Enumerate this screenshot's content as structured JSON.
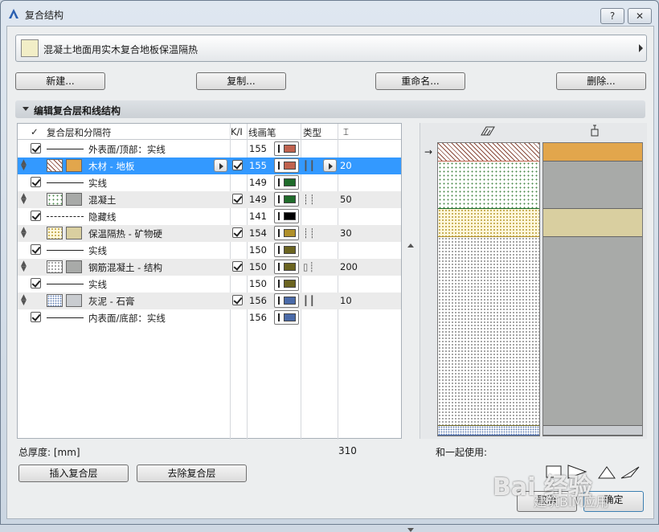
{
  "window": {
    "title": "复合结构",
    "help_label": "?",
    "close_label": "✕"
  },
  "selector": {
    "label": "混凝土地面用实木复合地板保温隔热"
  },
  "actions": {
    "new": "新建...",
    "copy": "复制...",
    "rename": "重命名...",
    "delete": "删除..."
  },
  "section": {
    "title": "编辑复合层和线结构"
  },
  "table": {
    "headers": {
      "check": "✓",
      "name": "复合层和分隔符",
      "vis": "K/I",
      "pen": "线画笔",
      "type": "类型",
      "thick": "⌶"
    },
    "rows": [
      {
        "kind": "line",
        "checked": true,
        "name": "外表面/顶部：实线",
        "pen": "155",
        "pen_color": "#c0624e",
        "dash": false
      },
      {
        "kind": "layer",
        "selected": true,
        "name": "木材 - 地板",
        "color": "#e2a64c",
        "hatch": "wood",
        "vis": true,
        "pen": "155",
        "pen_color": "#c0624e",
        "type": "┃┃",
        "thick": "20"
      },
      {
        "kind": "line",
        "checked": true,
        "name": "实线",
        "pen": "149",
        "pen_color": "#1f6b2a",
        "dash": false
      },
      {
        "kind": "layer",
        "name": "混凝土",
        "color": "#a8aaa8",
        "hatch": "concrete",
        "vis": true,
        "pen": "149",
        "pen_color": "#1f6b2a",
        "type": "┊┊",
        "thick": "50"
      },
      {
        "kind": "line",
        "checked": true,
        "name": "隐藏线",
        "pen": "141",
        "pen_color": "#000000",
        "dash": true
      },
      {
        "kind": "layer",
        "name": "保温隔热 - 矿物硬",
        "color": "#d9cfa0",
        "hatch": "insulation",
        "vis": true,
        "pen": "154",
        "pen_color": "#b0902a",
        "type": "┊┊",
        "thick": "30"
      },
      {
        "kind": "line",
        "checked": true,
        "name": "实线",
        "pen": "150",
        "pen_color": "#6b6420",
        "dash": false
      },
      {
        "kind": "layer",
        "name": "钢筋混凝土 - 结构",
        "color": "#a8aaa8",
        "hatch": "rc",
        "vis": true,
        "pen": "150",
        "pen_color": "#6b6420",
        "type": "▯┊",
        "thick": "200"
      },
      {
        "kind": "line",
        "checked": true,
        "name": "实线",
        "pen": "150",
        "pen_color": "#6b6420",
        "dash": false
      },
      {
        "kind": "layer",
        "name": "灰泥 - 石膏",
        "color": "#c9ccd0",
        "hatch": "plaster",
        "vis": true,
        "pen": "156",
        "pen_color": "#4a6aa8",
        "type": "┃┃",
        "thick": "10"
      },
      {
        "kind": "line",
        "checked": true,
        "name": "内表面/底部：实线",
        "pen": "156",
        "pen_color": "#4a6aa8",
        "dash": false
      }
    ]
  },
  "footer": {
    "total_label": "总厚度: [mm]",
    "total_value": "310",
    "insert": "插入复合层",
    "remove": "去除复合层",
    "used_with": "和一起使用:"
  },
  "dialog_buttons": {
    "cancel": "取消",
    "ok": "确定"
  },
  "watermark": {
    "baidu": "Bai 经验",
    "text": "建筑BIM应用"
  }
}
